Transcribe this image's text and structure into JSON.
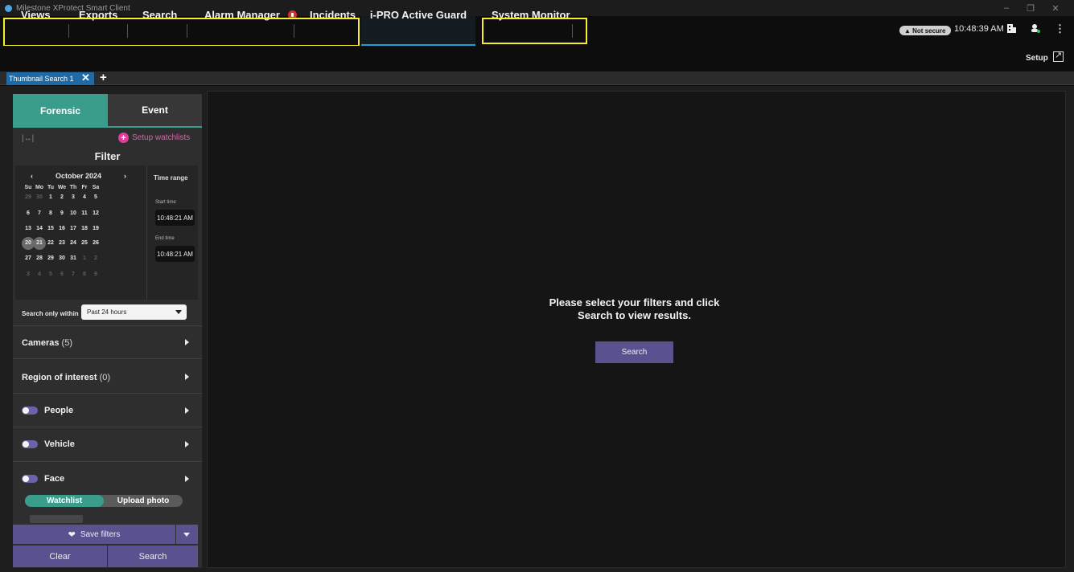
{
  "window": {
    "title": "Milestone XProtect Smart Client"
  },
  "nav": {
    "items": [
      "Views",
      "Exports",
      "Search",
      "Alarm Manager",
      "Incidents",
      "i-PRO Active Guard",
      "System Monitor"
    ],
    "active": "i-PRO Active Guard",
    "security_badge": "Not secure",
    "clock": "10:48:39 AM",
    "setup_label": "Setup"
  },
  "tabs": {
    "open_tab": "Thumbnail Search 1"
  },
  "panel": {
    "segments": [
      "Forensic",
      "Event"
    ],
    "setup_watchlists": "Setup watchlists",
    "filter_title": "Filter",
    "calendar": {
      "month": "October 2024",
      "weekdays": [
        "Su",
        "Mo",
        "Tu",
        "We",
        "Th",
        "Fr",
        "Sa"
      ],
      "rows": [
        [
          "29",
          "30",
          "1",
          "2",
          "3",
          "4",
          "5"
        ],
        [
          "6",
          "7",
          "8",
          "9",
          "10",
          "11",
          "12"
        ],
        [
          "13",
          "14",
          "15",
          "16",
          "17",
          "18",
          "19"
        ],
        [
          "20",
          "21",
          "22",
          "23",
          "24",
          "25",
          "26"
        ],
        [
          "27",
          "28",
          "29",
          "30",
          "31",
          "1",
          "2"
        ],
        [
          "3",
          "4",
          "5",
          "6",
          "7",
          "8",
          "9"
        ]
      ],
      "selected": [
        "20",
        "21"
      ]
    },
    "time_range": {
      "label": "Time range",
      "start_label": "Start time",
      "start_value": "10:48:21 AM",
      "end_label": "End time",
      "end_value": "10:48:21 AM"
    },
    "search_within": {
      "label": "Search only within",
      "value": "Past 24 hours"
    },
    "cameras": {
      "label": "Cameras",
      "count": "(5)"
    },
    "roi": {
      "label": "Region of interest",
      "count": "(0)"
    },
    "toggles": [
      "People",
      "Vehicle",
      "Face"
    ],
    "face_tabs": [
      "Watchlist",
      "Upload photo"
    ],
    "save_filters": "Save filters",
    "clear": "Clear",
    "search": "Search"
  },
  "main": {
    "prompt_line1": "Please select your filters and click",
    "prompt_line2": "Search to view results.",
    "search_button": "Search"
  },
  "colors": {
    "accent_teal": "#3a9d8c",
    "accent_purple": "#5a5190",
    "active_underline": "#1aa0d8",
    "highlight_yellow": "#f5ee2a",
    "alarm_red": "#d6302c"
  }
}
